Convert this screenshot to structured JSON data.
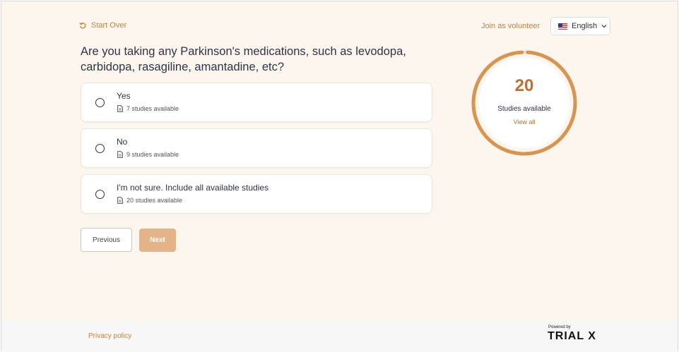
{
  "header": {
    "start_over": "Start Over",
    "join_volunteer": "Join as volunteer",
    "language": "English"
  },
  "question": "Are you taking any Parkinson's medications, such as levodopa, carbidopa, rasagiline, amantadine, etc?",
  "options": [
    {
      "label": "Yes",
      "sub": "7 studies available"
    },
    {
      "label": "No",
      "sub": "9 studies available"
    },
    {
      "label": "I'm not sure. Include all available studies",
      "sub": "20 studies available"
    }
  ],
  "buttons": {
    "previous": "Previous",
    "next": "Next"
  },
  "summary": {
    "count": "20",
    "label": "Studies available",
    "view_all": "View all"
  },
  "footer": {
    "privacy": "Privacy policy",
    "powered_by": "Powered by",
    "brand": "TRIAL X"
  },
  "colors": {
    "accent": "#c8823c",
    "background": "#fdf6ee",
    "next_button": "#e3b487"
  }
}
